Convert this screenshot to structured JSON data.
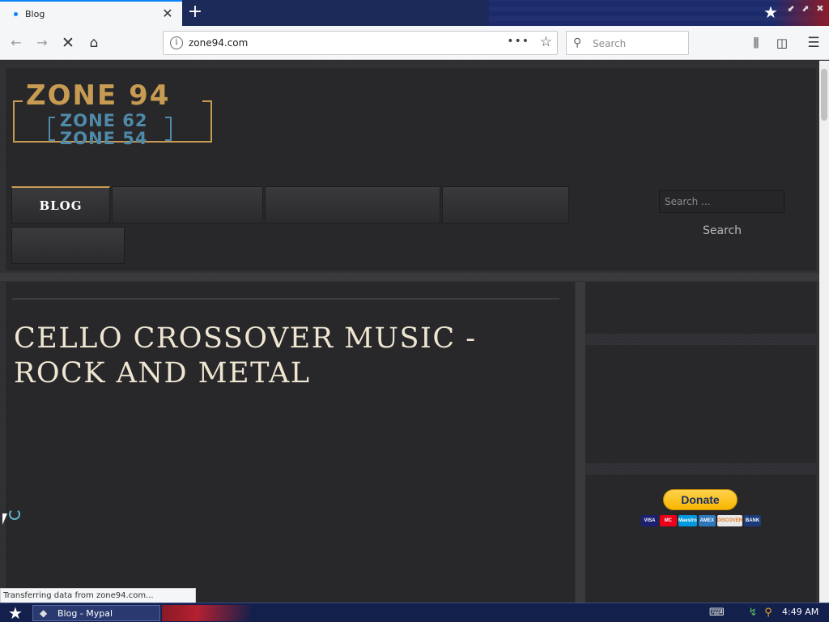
{
  "browser": {
    "tab_title": "Blog",
    "tab_close": "✕",
    "new_tab": "+",
    "url": "zone94.com",
    "url_more": "•••",
    "search_placeholder": "Search",
    "status_text": "Transferring data from zone94.com..."
  },
  "site": {
    "logo": {
      "line1": "ZONE 94",
      "line2": "ZONE 62",
      "line3": "ZONE 54"
    },
    "menu": {
      "active_item": "BLOG",
      "other_items": [
        "",
        "",
        "",
        "",
        ""
      ]
    },
    "search": {
      "placeholder": "Search ...",
      "button_label": "Search"
    },
    "post": {
      "title": "CELLO CROSSOVER MUSIC - ROCK AND METAL"
    },
    "donate": {
      "button_label": "Donate",
      "cards": [
        "VISA",
        "MC",
        "Maestro",
        "AMEX",
        "DISCOVER",
        "BANK"
      ]
    }
  },
  "taskbar": {
    "task_label": "Blog - Mypal",
    "clock": "4:49 AM"
  },
  "colors": {
    "accent": "#c89b52",
    "logo_secondary": "#4f8aa8",
    "page_bg": "#303034",
    "panel_bg": "#28282b",
    "browser_accent": "#0a84ff",
    "paypal_yellow": "#ffc439"
  }
}
